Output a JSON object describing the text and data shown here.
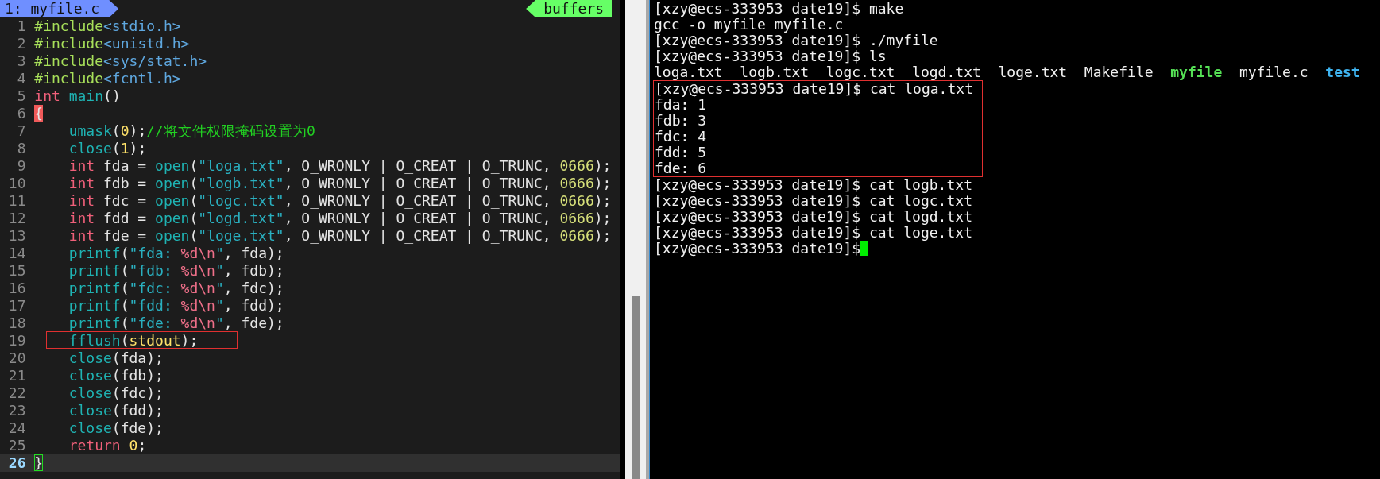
{
  "editor": {
    "tab": "1: myfile.c",
    "buffers_label": "buffers",
    "lines": [
      {
        "number": "1",
        "tokens": [
          {
            "kind": "preproc",
            "text": "#include"
          },
          {
            "kind": "header",
            "text": "<stdio.h>"
          }
        ]
      },
      {
        "number": "2",
        "tokens": [
          {
            "kind": "preproc",
            "text": "#include"
          },
          {
            "kind": "header",
            "text": "<unistd.h>"
          }
        ]
      },
      {
        "number": "3",
        "tokens": [
          {
            "kind": "preproc",
            "text": "#include"
          },
          {
            "kind": "header",
            "text": "<sys/stat.h>"
          }
        ]
      },
      {
        "number": "4",
        "tokens": [
          {
            "kind": "preproc",
            "text": "#include"
          },
          {
            "kind": "header",
            "text": "<fcntl.h>"
          }
        ]
      },
      {
        "number": "5",
        "tokens": [
          {
            "kind": "keyword",
            "text": "int "
          },
          {
            "kind": "func",
            "text": "main"
          },
          {
            "kind": "plain",
            "text": "()"
          }
        ]
      },
      {
        "number": "6",
        "tokens": [
          {
            "kind": "paren-match",
            "text": "{"
          }
        ]
      },
      {
        "number": "7",
        "indented": true,
        "tokens": [
          {
            "kind": "func",
            "text": "umask"
          },
          {
            "kind": "plain",
            "text": "("
          },
          {
            "kind": "number",
            "text": "0"
          },
          {
            "kind": "plain",
            "text": ");"
          },
          {
            "kind": "comment",
            "text": "//将文件权限掩码设置为0"
          }
        ]
      },
      {
        "number": "8",
        "indented": true,
        "tokens": [
          {
            "kind": "func",
            "text": "close"
          },
          {
            "kind": "plain",
            "text": "("
          },
          {
            "kind": "number",
            "text": "1"
          },
          {
            "kind": "plain",
            "text": ");"
          }
        ]
      },
      {
        "number": "9",
        "indented": true,
        "tokens": [
          {
            "kind": "keyword",
            "text": "int"
          },
          {
            "kind": "plain",
            "text": " fda = "
          },
          {
            "kind": "func",
            "text": "open"
          },
          {
            "kind": "plain",
            "text": "("
          },
          {
            "kind": "string",
            "text": "\"loga.txt\""
          },
          {
            "kind": "plain",
            "text": ", O_WRONLY | O_CREAT | O_TRUNC, "
          },
          {
            "kind": "octal",
            "text": "0666"
          },
          {
            "kind": "plain",
            "text": ");"
          }
        ]
      },
      {
        "number": "10",
        "indented": true,
        "tokens": [
          {
            "kind": "keyword",
            "text": "int"
          },
          {
            "kind": "plain",
            "text": " fdb = "
          },
          {
            "kind": "func",
            "text": "open"
          },
          {
            "kind": "plain",
            "text": "("
          },
          {
            "kind": "string",
            "text": "\"logb.txt\""
          },
          {
            "kind": "plain",
            "text": ", O_WRONLY | O_CREAT | O_TRUNC, "
          },
          {
            "kind": "octal",
            "text": "0666"
          },
          {
            "kind": "plain",
            "text": ");"
          }
        ]
      },
      {
        "number": "11",
        "indented": true,
        "tokens": [
          {
            "kind": "keyword",
            "text": "int"
          },
          {
            "kind": "plain",
            "text": " fdc = "
          },
          {
            "kind": "func",
            "text": "open"
          },
          {
            "kind": "plain",
            "text": "("
          },
          {
            "kind": "string",
            "text": "\"logc.txt\""
          },
          {
            "kind": "plain",
            "text": ", O_WRONLY | O_CREAT | O_TRUNC, "
          },
          {
            "kind": "octal",
            "text": "0666"
          },
          {
            "kind": "plain",
            "text": ");"
          }
        ]
      },
      {
        "number": "12",
        "indented": true,
        "tokens": [
          {
            "kind": "keyword",
            "text": "int"
          },
          {
            "kind": "plain",
            "text": " fdd = "
          },
          {
            "kind": "func",
            "text": "open"
          },
          {
            "kind": "plain",
            "text": "("
          },
          {
            "kind": "string",
            "text": "\"logd.txt\""
          },
          {
            "kind": "plain",
            "text": ", O_WRONLY | O_CREAT | O_TRUNC, "
          },
          {
            "kind": "octal",
            "text": "0666"
          },
          {
            "kind": "plain",
            "text": ");"
          }
        ]
      },
      {
        "number": "13",
        "indented": true,
        "tokens": [
          {
            "kind": "keyword",
            "text": "int"
          },
          {
            "kind": "plain",
            "text": " fde = "
          },
          {
            "kind": "func",
            "text": "open"
          },
          {
            "kind": "plain",
            "text": "("
          },
          {
            "kind": "string",
            "text": "\"loge.txt\""
          },
          {
            "kind": "plain",
            "text": ", O_WRONLY | O_CREAT | O_TRUNC, "
          },
          {
            "kind": "octal",
            "text": "0666"
          },
          {
            "kind": "plain",
            "text": ");"
          }
        ]
      },
      {
        "number": "14",
        "indented": true,
        "tokens": [
          {
            "kind": "func",
            "text": "printf"
          },
          {
            "kind": "plain",
            "text": "("
          },
          {
            "kind": "string",
            "text": "\"fda: "
          },
          {
            "kind": "format",
            "text": "%d\\n"
          },
          {
            "kind": "string",
            "text": "\""
          },
          {
            "kind": "plain",
            "text": ", fda);"
          }
        ]
      },
      {
        "number": "15",
        "indented": true,
        "tokens": [
          {
            "kind": "func",
            "text": "printf"
          },
          {
            "kind": "plain",
            "text": "("
          },
          {
            "kind": "string",
            "text": "\"fdb: "
          },
          {
            "kind": "format",
            "text": "%d\\n"
          },
          {
            "kind": "string",
            "text": "\""
          },
          {
            "kind": "plain",
            "text": ", fdb);"
          }
        ]
      },
      {
        "number": "16",
        "indented": true,
        "tokens": [
          {
            "kind": "func",
            "text": "printf"
          },
          {
            "kind": "plain",
            "text": "("
          },
          {
            "kind": "string",
            "text": "\"fdc: "
          },
          {
            "kind": "format",
            "text": "%d\\n"
          },
          {
            "kind": "string",
            "text": "\""
          },
          {
            "kind": "plain",
            "text": ", fdc);"
          }
        ]
      },
      {
        "number": "17",
        "indented": true,
        "tokens": [
          {
            "kind": "func",
            "text": "printf"
          },
          {
            "kind": "plain",
            "text": "("
          },
          {
            "kind": "string",
            "text": "\"fdd: "
          },
          {
            "kind": "format",
            "text": "%d\\n"
          },
          {
            "kind": "string",
            "text": "\""
          },
          {
            "kind": "plain",
            "text": ", fdd);"
          }
        ]
      },
      {
        "number": "18",
        "indented": true,
        "tokens": [
          {
            "kind": "func",
            "text": "printf"
          },
          {
            "kind": "plain",
            "text": "("
          },
          {
            "kind": "string",
            "text": "\"fde: "
          },
          {
            "kind": "format",
            "text": "%d\\n"
          },
          {
            "kind": "string",
            "text": "\""
          },
          {
            "kind": "plain",
            "text": ", fde);"
          }
        ]
      },
      {
        "number": "19",
        "indented": true,
        "boxed": true,
        "tokens": [
          {
            "kind": "func",
            "text": "fflush"
          },
          {
            "kind": "plain",
            "text": "("
          },
          {
            "kind": "number",
            "text": "stdout"
          },
          {
            "kind": "plain",
            "text": ");"
          }
        ]
      },
      {
        "number": "20",
        "indented": true,
        "tokens": [
          {
            "kind": "func",
            "text": "close"
          },
          {
            "kind": "plain",
            "text": "(fda);"
          }
        ]
      },
      {
        "number": "21",
        "indented": true,
        "tokens": [
          {
            "kind": "func",
            "text": "close"
          },
          {
            "kind": "plain",
            "text": "(fdb);"
          }
        ]
      },
      {
        "number": "22",
        "indented": true,
        "tokens": [
          {
            "kind": "func",
            "text": "close"
          },
          {
            "kind": "plain",
            "text": "(fdc);"
          }
        ]
      },
      {
        "number": "23",
        "indented": true,
        "tokens": [
          {
            "kind": "func",
            "text": "close"
          },
          {
            "kind": "plain",
            "text": "(fdd);"
          }
        ]
      },
      {
        "number": "24",
        "indented": true,
        "tokens": [
          {
            "kind": "func",
            "text": "close"
          },
          {
            "kind": "plain",
            "text": "(fde);"
          }
        ]
      },
      {
        "number": "25",
        "indented": true,
        "tokens": [
          {
            "kind": "keyword",
            "text": "return "
          },
          {
            "kind": "number",
            "text": "0"
          },
          {
            "kind": "plain",
            "text": ";"
          }
        ]
      },
      {
        "number": "26",
        "current": true,
        "tokens": [
          {
            "kind": "cursor",
            "text": "}"
          }
        ]
      }
    ]
  },
  "terminal": {
    "blocks": [
      {
        "boxed": false,
        "lines": [
          {
            "tokens": [
              {
                "kind": "plain",
                "text": "[xzy@ecs-333953 date19]$ make"
              }
            ]
          },
          {
            "tokens": [
              {
                "kind": "plain",
                "text": "gcc -o myfile myfile.c"
              }
            ]
          },
          {
            "tokens": [
              {
                "kind": "plain",
                "text": "[xzy@ecs-333953 date19]$ ./myfile"
              }
            ]
          },
          {
            "tokens": [
              {
                "kind": "plain",
                "text": "[xzy@ecs-333953 date19]$ ls"
              }
            ]
          },
          {
            "tokens": [
              {
                "kind": "plain",
                "text": "loga.txt  logb.txt  logc.txt  logd.txt  loge.txt  Makefile  "
              },
              {
                "kind": "executable",
                "text": "myfile"
              },
              {
                "kind": "plain",
                "text": "  myfile.c  "
              },
              {
                "kind": "directory",
                "text": "test"
              }
            ]
          }
        ]
      },
      {
        "boxed": true,
        "lines": [
          {
            "tokens": [
              {
                "kind": "plain",
                "text": "[xzy@ecs-333953 date19]$ cat loga.txt"
              }
            ]
          },
          {
            "tokens": [
              {
                "kind": "plain",
                "text": "fda: 1"
              }
            ]
          },
          {
            "tokens": [
              {
                "kind": "plain",
                "text": "fdb: 3"
              }
            ]
          },
          {
            "tokens": [
              {
                "kind": "plain",
                "text": "fdc: 4"
              }
            ]
          },
          {
            "tokens": [
              {
                "kind": "plain",
                "text": "fdd: 5"
              }
            ]
          },
          {
            "tokens": [
              {
                "kind": "plain",
                "text": "fde: 6"
              }
            ]
          }
        ]
      },
      {
        "boxed": false,
        "lines": [
          {
            "tokens": [
              {
                "kind": "plain",
                "text": "[xzy@ecs-333953 date19]$ cat logb.txt"
              }
            ]
          },
          {
            "tokens": [
              {
                "kind": "plain",
                "text": "[xzy@ecs-333953 date19]$ cat logc.txt"
              }
            ]
          },
          {
            "tokens": [
              {
                "kind": "plain",
                "text": "[xzy@ecs-333953 date19]$ cat logd.txt"
              }
            ]
          },
          {
            "tokens": [
              {
                "kind": "plain",
                "text": "[xzy@ecs-333953 date19]$ cat loge.txt"
              }
            ]
          },
          {
            "cursor": true,
            "tokens": [
              {
                "kind": "plain",
                "text": "[xzy@ecs-333953 date19]$"
              }
            ]
          }
        ]
      }
    ]
  }
}
